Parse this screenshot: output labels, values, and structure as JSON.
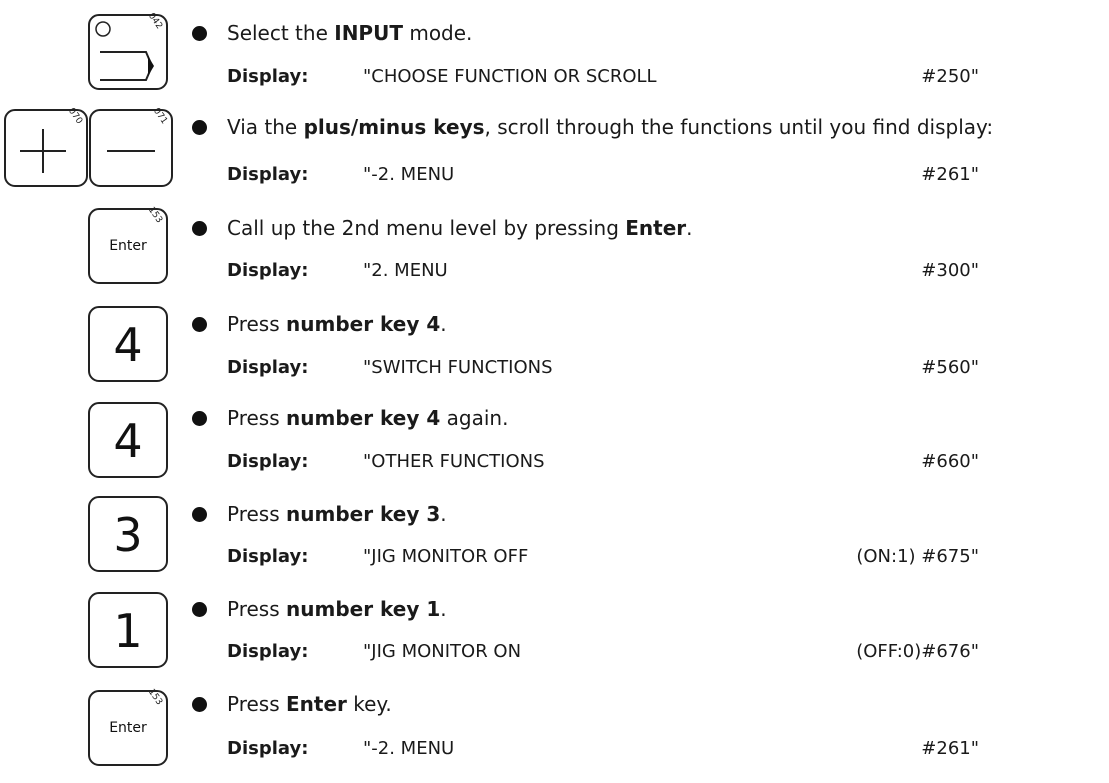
{
  "display_label": "Display:",
  "steps": [
    {
      "key": {
        "type": "input",
        "code": "042"
      },
      "instruction": {
        "pre": "Select the ",
        "bold": "INPUT",
        "post": " mode."
      },
      "display": {
        "text": "\"CHOOSE FUNCTION OR SCROLL",
        "code": "#250\""
      }
    },
    {
      "key": {
        "type": "plusminus",
        "plus_code": "070",
        "minus_code": "071"
      },
      "instruction": {
        "pre": "Via the ",
        "bold": "plus/minus keys",
        "post": ", scroll through the functions until you find display:"
      },
      "display": {
        "text": "\"-2. MENU",
        "code": "#261\""
      }
    },
    {
      "key": {
        "type": "enter",
        "label": "Enter",
        "code": "153"
      },
      "instruction": {
        "pre": "Call up the 2nd menu level by pressing ",
        "bold": "Enter",
        "post": "."
      },
      "display": {
        "text": "\"2. MENU",
        "code": "#300\""
      }
    },
    {
      "key": {
        "type": "number",
        "label": "4"
      },
      "instruction": {
        "pre": "Press ",
        "bold": "number key 4",
        "post": "."
      },
      "display": {
        "text": "\"SWITCH FUNCTIONS",
        "code": "#560\""
      }
    },
    {
      "key": {
        "type": "number",
        "label": "4"
      },
      "instruction": {
        "pre": "Press ",
        "bold": "number key 4",
        "post": " again."
      },
      "display": {
        "text": "\"OTHER FUNCTIONS",
        "code": "#660\""
      }
    },
    {
      "key": {
        "type": "number",
        "label": "3"
      },
      "instruction": {
        "pre": "Press ",
        "bold": "number key 3",
        "post": "."
      },
      "display": {
        "text": "\"JIG MONITOR OFF",
        "code": "(ON:1) #675\""
      }
    },
    {
      "key": {
        "type": "number",
        "label": "1"
      },
      "instruction": {
        "pre": "Press ",
        "bold": "number key 1",
        "post": "."
      },
      "display": {
        "text": "\"JIG MONITOR ON",
        "code": "(OFF:0)#676\""
      }
    },
    {
      "key": {
        "type": "enter",
        "label": "Enter",
        "code": "153"
      },
      "instruction": {
        "pre": "Press ",
        "bold": "Enter",
        "post": " key."
      },
      "display": {
        "text": "\"-2. MENU",
        "code": "#261\""
      }
    }
  ]
}
